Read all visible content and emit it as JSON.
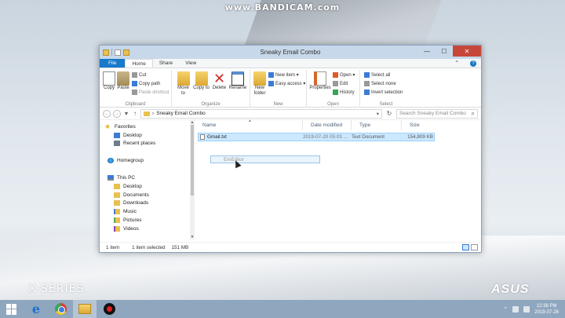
{
  "watermark": "www.BANDICAM.com",
  "desktop": {
    "brand_left": "X·SERIES",
    "brand_right": "ASUS"
  },
  "window": {
    "title": "Sneaky Email Combo",
    "controls": {
      "minimize": "—",
      "maximize": "☐",
      "close": "✕"
    }
  },
  "ribbon_tabs": [
    "File",
    "Home",
    "Share",
    "View"
  ],
  "ribbon": {
    "clipboard": {
      "label": "Clipboard",
      "copy": "Copy",
      "paste": "Paste",
      "cut": "Cut",
      "copy_path": "Copy path",
      "paste_shortcut": "Paste shortcut"
    },
    "organize": {
      "label": "Organize",
      "move_to": "Move to",
      "copy_to": "Copy to",
      "delete": "Delete",
      "rename": "Rename"
    },
    "new": {
      "label": "New",
      "new_folder": "New folder",
      "new_item": "New item ▾",
      "easy_access": "Easy access ▾"
    },
    "open": {
      "label": "Open",
      "properties": "Properties",
      "open": "Open ▾",
      "edit": "Edit",
      "history": "History"
    },
    "select": {
      "label": "Select",
      "select_all": "Select all",
      "select_none": "Select none",
      "invert": "Invert selection"
    }
  },
  "address": {
    "path": "Sneaky Email Combo",
    "search_placeholder": "Search Sneaky Email Combo"
  },
  "nav": {
    "favorites": "Favorites",
    "desktop": "Desktop",
    "recent": "Recent places",
    "homegroup": "Homegroup",
    "this_pc": "This PC",
    "pc_items": [
      "Desktop",
      "Documents",
      "Downloads",
      "Music",
      "Pictures",
      "Videos"
    ]
  },
  "columns": {
    "name": "Name",
    "date": "Date modified",
    "type": "Type",
    "size": "Size"
  },
  "files": [
    {
      "name": "Gmail.txt",
      "date": "2019-07-20 05:03 ...",
      "type": "Text Document",
      "size": "154,809 KB"
    }
  ],
  "drag_label": "EmEditor",
  "status": {
    "count": "1 item",
    "selected": "1 item selected",
    "size": "151 MB"
  },
  "taskbar": {
    "time": "12:38 PM",
    "date": "2019-07-28"
  }
}
